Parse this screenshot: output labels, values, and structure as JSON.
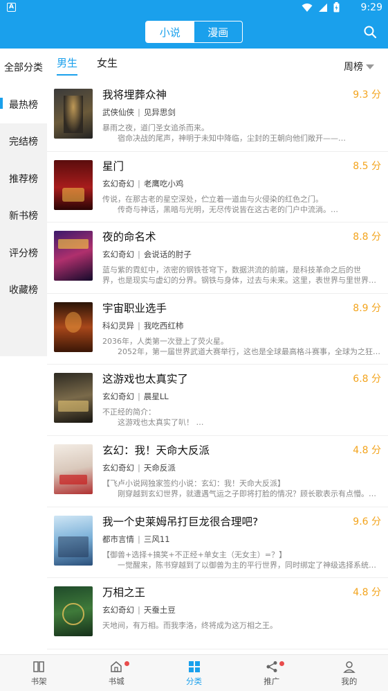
{
  "status": {
    "time": "9:29",
    "app_icon": "A"
  },
  "header": {
    "tabs": [
      {
        "label": "小说",
        "active": true
      },
      {
        "label": "漫画",
        "active": false
      }
    ],
    "accent": "#1aa0ec"
  },
  "sidebar": {
    "all_label": "全部分类",
    "items": [
      {
        "label": "最热榜",
        "active": true
      },
      {
        "label": "完结榜",
        "active": false
      },
      {
        "label": "推荐榜",
        "active": false
      },
      {
        "label": "新书榜",
        "active": false
      },
      {
        "label": "评分榜",
        "active": false
      },
      {
        "label": "收藏榜",
        "active": false
      }
    ]
  },
  "gender_tabs": [
    {
      "label": "男生",
      "active": true
    },
    {
      "label": "女生",
      "active": false
    }
  ],
  "period": {
    "label": "周榜"
  },
  "books": [
    {
      "title": "我将埋葬众神",
      "score": "9.3 分",
      "category": "武侠仙侠",
      "author": "见异思剑",
      "line1": "暴雨之夜，道门圣女追杀而来。",
      "line2": "宿命决战的尾声，神明于未知中降临，尘封的王朝向他们敞开——…"
    },
    {
      "title": "星门",
      "score": "8.5 分",
      "category": "玄幻奇幻",
      "author": "老鹰吃小鸡",
      "line1": "传说，在那古老的星空深处，伫立着一道血与火侵染的红色之门。",
      "line2": "传奇与神话，黑暗与光明，无尽传说皆在这古老的门户中流淌。…"
    },
    {
      "title": "夜的命名术",
      "score": "8.8 分",
      "category": "玄幻奇幻",
      "author": "会说话的肘子",
      "line1": "蓝与紫的霓虹中，浓密的钢铁苍穹下，数据洪流的前端，是科技革命之后的世",
      "line2": "界，也是现实与虚幻的分界。钢铁与身体，过去与未来。这里，表世界与里世界…",
      "l2_indent": false
    },
    {
      "title": "宇宙职业选手",
      "score": "8.9 分",
      "category": "科幻灵异",
      "author": "我吃西红柿",
      "line1": "2036年，人类第一次登上了荧火星。",
      "line2": "2052年，第一届世界武道大赛举行，这也是全球最高格斗赛事，全球为之狂…"
    },
    {
      "title": "这游戏也太真实了",
      "score": "6.8 分",
      "category": "玄幻奇幻",
      "author": "晨星LL",
      "line1": "不正经的简介：",
      "line2": "这游戏也太真实了叭！ …"
    },
    {
      "title": "玄幻：我！天命大反派",
      "score": "4.8 分",
      "category": "玄幻奇幻",
      "author": "天命反派",
      "line1": "【飞卢小说网独家签约小说：玄幻：我！天命大反派】",
      "line2": "刚穿越到玄幻世界，就遭遇气运之子即将打脸的情况？顾长歌表示有点懵。…"
    },
    {
      "title": "我一个史莱姆吊打巨龙很合理吧?",
      "score": "9.6 分",
      "category": "都市言情",
      "author": "三风11",
      "line1": "【御兽+选择+搞笑+不正经+单女主（无女主）=？】",
      "line2": "一觉醒来，陈书穿越到了以御兽为主的平行世界，同时绑定了神级选择系统…"
    },
    {
      "title": "万相之王",
      "score": "4.8 分",
      "category": "玄幻奇幻",
      "author": "天蚕土豆",
      "line1": "天地间，有万相。而我李洛，终将成为这万相之王。",
      "line2": ""
    }
  ],
  "bottom_nav": [
    {
      "label": "书架",
      "icon": "bookshelf-icon",
      "active": false,
      "badge": false
    },
    {
      "label": "书城",
      "icon": "home-icon",
      "active": false,
      "badge": true
    },
    {
      "label": "分类",
      "icon": "category-icon",
      "active": true,
      "badge": false
    },
    {
      "label": "推广",
      "icon": "share-icon",
      "active": false,
      "badge": true
    },
    {
      "label": "我的",
      "icon": "profile-icon",
      "active": false,
      "badge": false
    }
  ]
}
